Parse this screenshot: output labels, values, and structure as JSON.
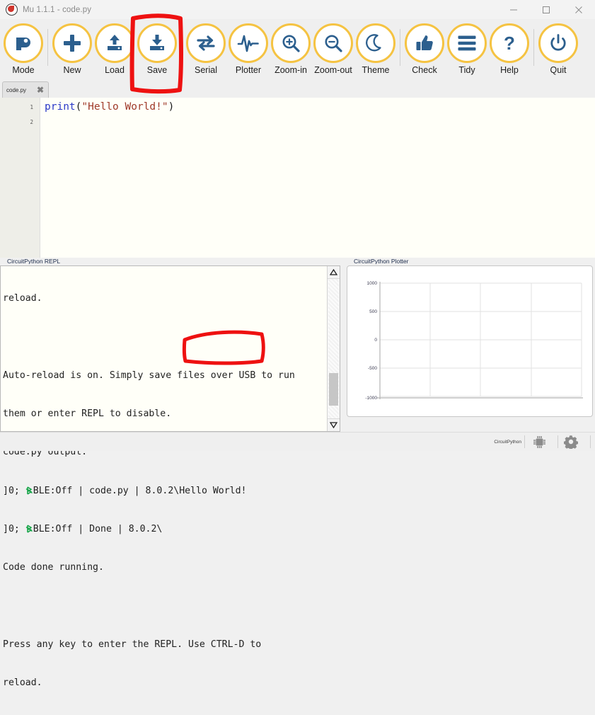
{
  "window": {
    "title": "Mu 1.1.1 - code.py",
    "logo_icon": "mu-logo-icon",
    "controls": [
      {
        "name": "minimize",
        "icon": "minimize-icon"
      },
      {
        "name": "maximize",
        "icon": "maximize-icon"
      },
      {
        "name": "close",
        "icon": "close-icon"
      }
    ]
  },
  "toolbar": {
    "accent_color": "#f5c342",
    "icon_color": "#2c5f8e",
    "buttons": [
      {
        "label": "Mode",
        "icon": "mode-icon"
      },
      {
        "label": "New",
        "icon": "plus-icon"
      },
      {
        "label": "Load",
        "icon": "upload-icon"
      },
      {
        "label": "Save",
        "icon": "download-save-icon"
      },
      {
        "label": "Serial",
        "icon": "exchange-arrows-icon"
      },
      {
        "label": "Plotter",
        "icon": "waveform-icon"
      },
      {
        "label": "Zoom-in",
        "icon": "magnifier-plus-icon"
      },
      {
        "label": "Zoom-out",
        "icon": "magnifier-minus-icon"
      },
      {
        "label": "Theme",
        "icon": "moon-icon"
      },
      {
        "label": "Check",
        "icon": "thumbs-up-icon"
      },
      {
        "label": "Tidy",
        "icon": "lines-icon"
      },
      {
        "label": "Help",
        "icon": "question-mark-icon"
      },
      {
        "label": "Quit",
        "icon": "power-icon"
      }
    ]
  },
  "tabs": [
    {
      "label": "code.py",
      "close_icon": "close-icon",
      "active": true
    }
  ],
  "editor": {
    "line_numbers": [
      "1",
      "2"
    ],
    "code_tokens": [
      {
        "text": "print",
        "type": "function"
      },
      {
        "text": "(",
        "type": "punctuation"
      },
      {
        "text": "\"Hello World!\"",
        "type": "string"
      },
      {
        "text": ")",
        "type": "punctuation"
      }
    ],
    "background_color": "#fffff8"
  },
  "repl": {
    "title": "CircuitPython REPL",
    "lines": [
      {
        "text": "reload.",
        "ble": false
      },
      {
        "text": "",
        "ble": false
      },
      {
        "text": "Auto-reload is on. Simply save files over USB to run",
        "ble": false
      },
      {
        "text": "them or enter REPL to disable.",
        "ble": false
      },
      {
        "text": "code.py output:",
        "ble": false
      },
      {
        "pre": "]0; ",
        "ble": true,
        "post": "BLE:Off | code.py | 8.0.2\\Hello World!"
      },
      {
        "pre": "]0; ",
        "ble": true,
        "post": "BLE:Off | Done | 8.0.2\\"
      },
      {
        "text": "Code done running.",
        "ble": false
      },
      {
        "text": "",
        "ble": false
      },
      {
        "text": "Press any key to enter the REPL. Use CTRL-D to",
        "ble": false
      },
      {
        "text": "reload.",
        "ble": false
      }
    ],
    "scrollbar": {
      "up_arrow_icon": "triangle-up-icon",
      "down_arrow_icon": "triangle-down-icon"
    }
  },
  "plotter": {
    "title": "CircuitPython Plotter"
  },
  "chart_data": {
    "type": "line",
    "title": "CircuitPython Plotter",
    "series": [],
    "x": [],
    "xlabel": "",
    "ylabel": "",
    "y_ticks": [
      1000,
      500,
      0,
      -500,
      -1000
    ],
    "ylim": [
      -1000,
      1000
    ],
    "grid": true,
    "legend": "none",
    "note": "empty plot - no data traces"
  },
  "statusbar": {
    "mode_label": "CircuitPython",
    "buttons": [
      {
        "name": "device-chip",
        "icon": "chip-icon"
      },
      {
        "name": "settings",
        "icon": "gear-icon"
      }
    ]
  },
  "annotations": {
    "color": "#ee1111",
    "items": [
      {
        "name": "save-button-highlight",
        "shape": "rectangle",
        "target": "Save"
      },
      {
        "name": "hello-world-output-highlight",
        "shape": "rectangle",
        "target": "Hello World!"
      }
    ]
  }
}
